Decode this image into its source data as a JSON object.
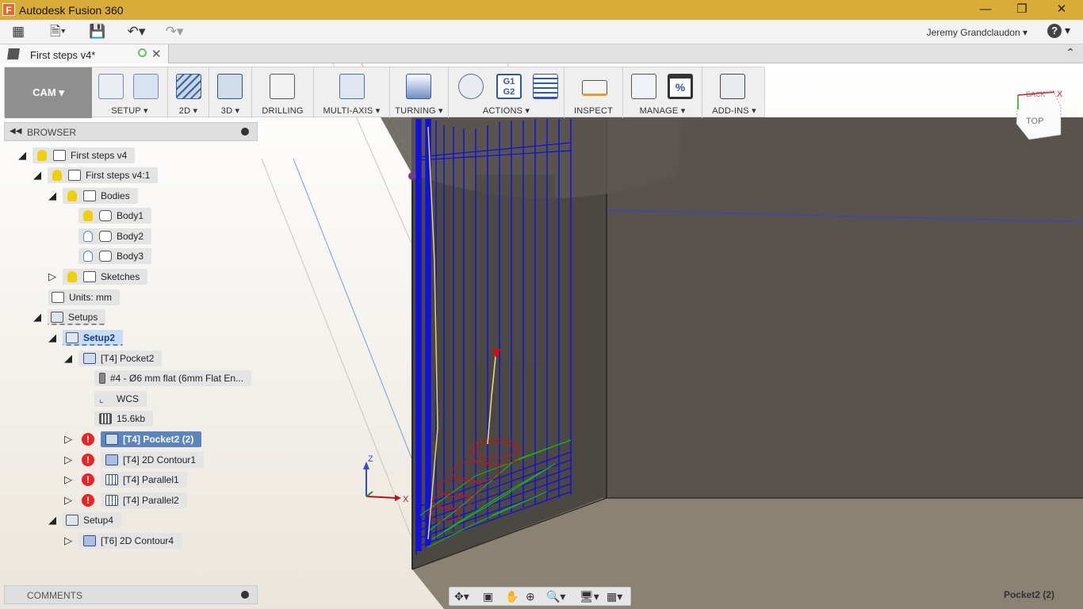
{
  "window": {
    "title": "Autodesk Fusion 360",
    "app_icon": "F"
  },
  "qat": {
    "user": "Jeremy Grandclaudon",
    "help_label": "?"
  },
  "tabs": {
    "document": "First steps v4*"
  },
  "ribbon": {
    "workspace": "CAM",
    "groups": [
      "SETUP",
      "2D",
      "3D",
      "DRILLING",
      "MULTI-AXIS",
      "TURNING",
      "ACTIONS",
      "INSPECT",
      "MANAGE",
      "ADD-INS"
    ],
    "actions_icon_text": "G1\nG2",
    "manage_icon_text": "%"
  },
  "browser": {
    "title": "BROWSER",
    "nodes": [
      {
        "label": "First steps v4"
      },
      {
        "label": "First steps v4:1"
      },
      {
        "label": "Bodies"
      },
      {
        "label": "Body1"
      },
      {
        "label": "Body2"
      },
      {
        "label": "Body3"
      },
      {
        "label": "Sketches"
      },
      {
        "label": "Units: mm"
      },
      {
        "label": "Setups"
      },
      {
        "label": "Setup2"
      },
      {
        "label": "[T4] Pocket2"
      },
      {
        "label": "#4 - Ø6 mm flat (6mm Flat En..."
      },
      {
        "label": "WCS"
      },
      {
        "label": "15.6kb"
      },
      {
        "label": "[T4] Pocket2 (2)"
      },
      {
        "label": "[T4] 2D Contour1"
      },
      {
        "label": "[T4] Parallel1"
      },
      {
        "label": "[T4] Parallel2"
      },
      {
        "label": "Setup4"
      },
      {
        "label": "[T6] 2D Contour4"
      }
    ],
    "error_mark": "!"
  },
  "comments": {
    "title": "COMMENTS"
  },
  "viewcube": {
    "face": "TOP",
    "face2": "BACK",
    "axis_x": "X"
  },
  "triad": {
    "x": "X",
    "z": "Z"
  },
  "status": {
    "selection": "Pocket2 (2)"
  },
  "colors": {
    "titlebar": "#d9ac3a",
    "toolpath_blue": "#1010e0",
    "toolpath_green": "#1ab01a",
    "toolpath_red": "#d01010",
    "stock": "#555048"
  }
}
